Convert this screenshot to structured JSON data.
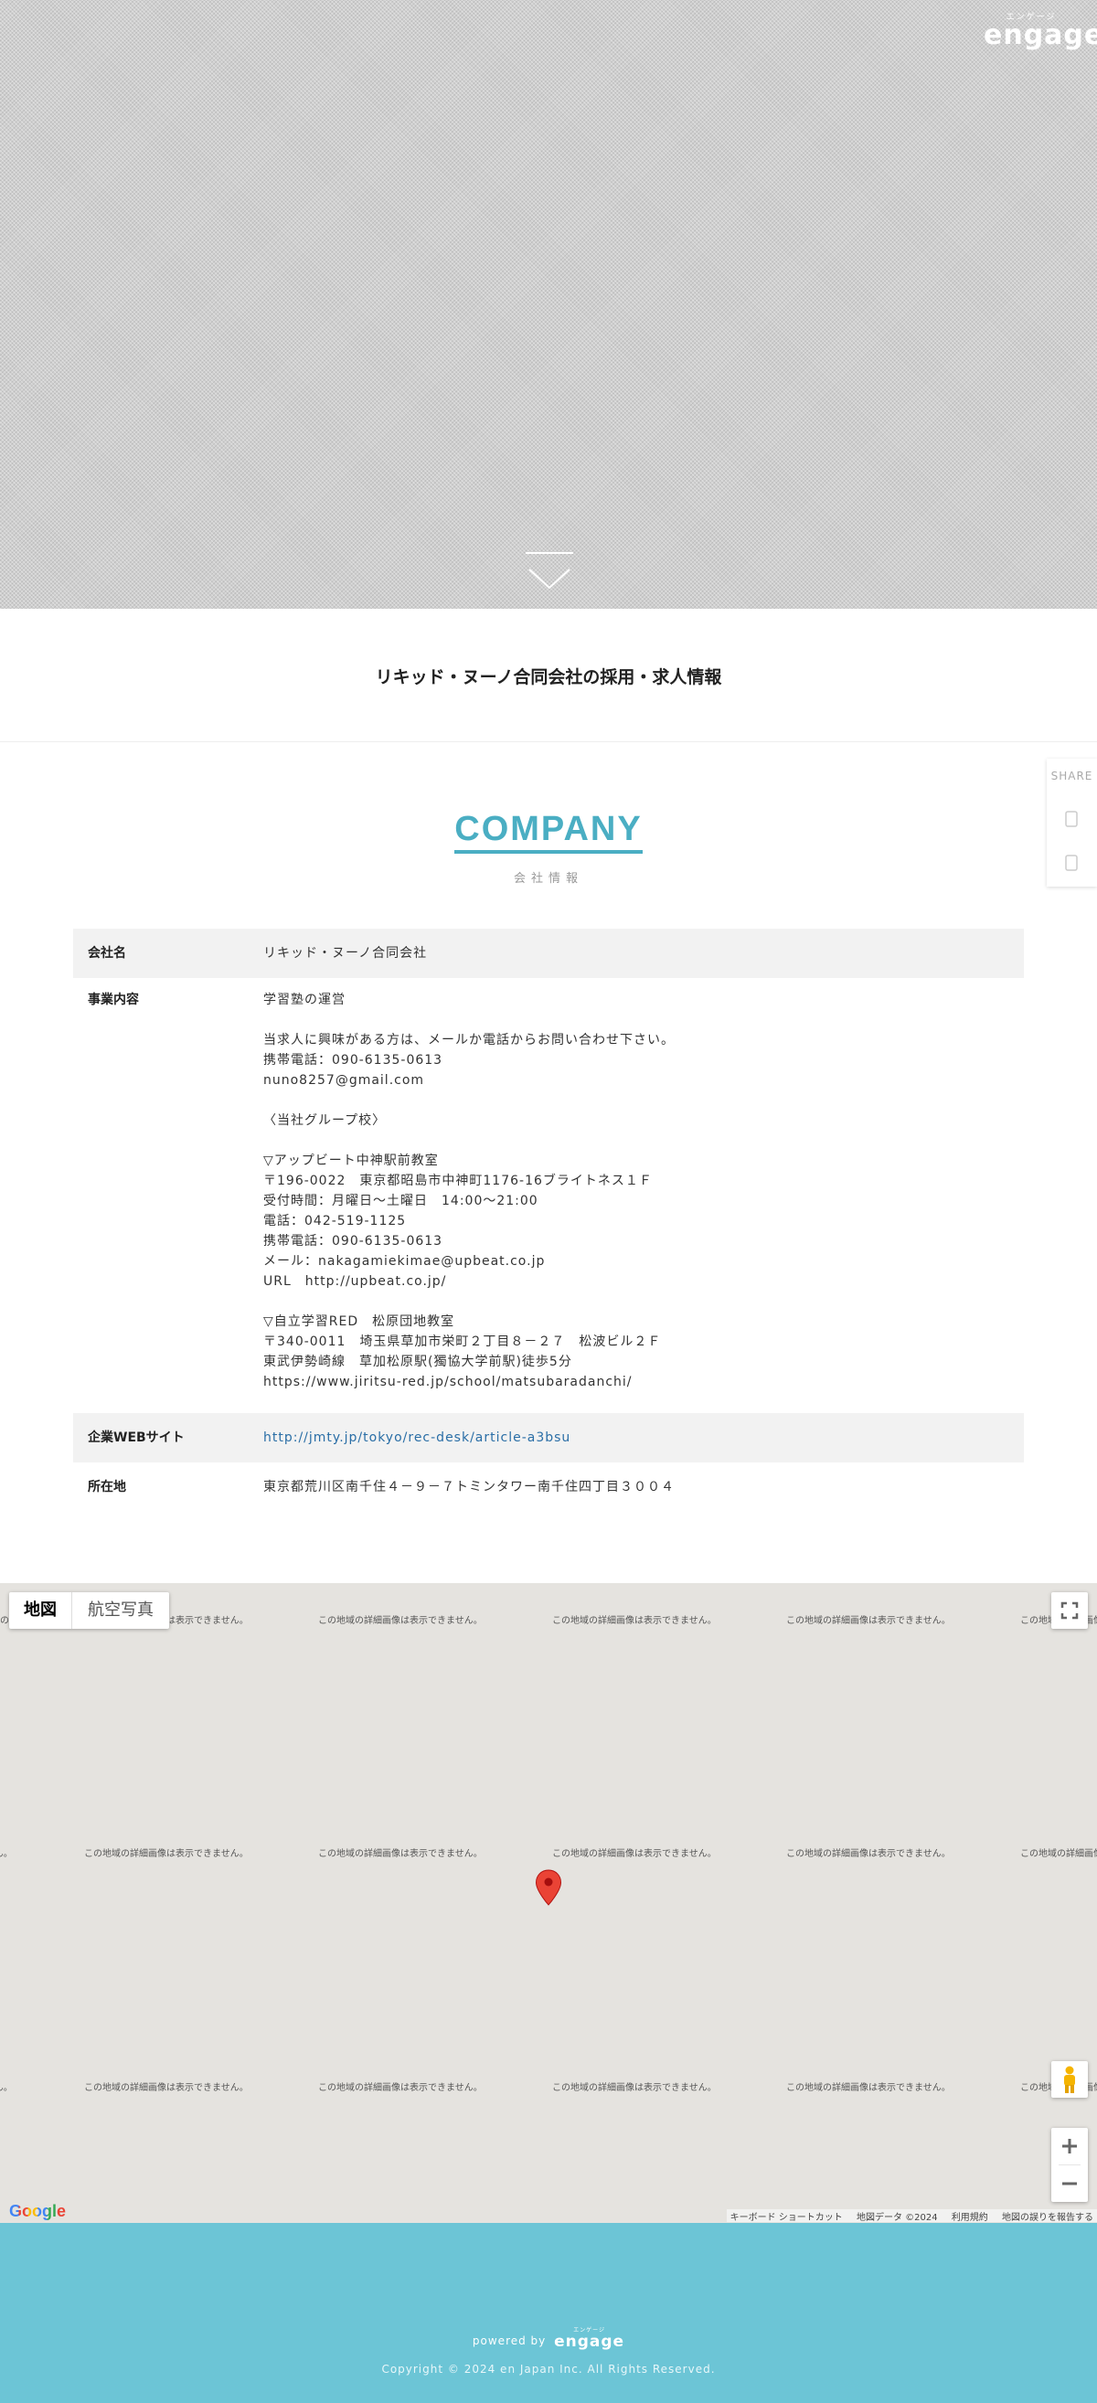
{
  "header": {
    "logo_kana": "エンゲージ",
    "logo_word": "engage"
  },
  "page_title": "リキッド・ヌーノ合同会社の採用・求人情報",
  "share": {
    "label": "SHARE"
  },
  "company": {
    "heading_en": "COMPANY",
    "heading_ja": "会社情報",
    "rows": {
      "name": {
        "label": "会社名",
        "value": "リキッド・ヌーノ合同会社"
      },
      "business": {
        "label": "事業内容",
        "lines": [
          "学習塾の運営",
          "",
          "当求人に興味がある方は、メールか電話からお問い合わせ下さい。",
          "携帯電話：090-6135-0613",
          "nuno8257@gmail.com",
          "",
          "〈当社グループ校〉",
          "",
          "▽アップビート中神駅前教室",
          "〒196-0022　東京都昭島市中神町1176-16ブライトネス１Ｆ",
          "受付時間：月曜日～土曜日　14:00～21:00",
          "電話：042-519-1125",
          "携帯電話：090-6135-0613",
          "メール：nakagamiekimae@upbeat.co.jp",
          "URL　http://upbeat.co.jp/",
          "",
          "▽自立学習RED　松原団地教室",
          "〒340-0011　埼玉県草加市栄町２丁目８－２７　松波ビル２Ｆ",
          "東武伊勢崎線　草加松原駅(獨協大学前駅)徒歩5分",
          "https://www.jiritsu-red.jp/school/matsubaradanchi/"
        ]
      },
      "website": {
        "label": "企業WEBサイト",
        "value": "http://jmty.jp/tokyo/rec-desk/article-a3bsu"
      },
      "address": {
        "label": "所在地",
        "value": "東京都荒川区南千住４－９－７トミンタワー南千住四丁目３００４"
      }
    }
  },
  "map": {
    "type_map": "地図",
    "type_satellite": "航空写真",
    "tile_message": "この地域の詳細画像は表示できません。",
    "google_logo": "Google",
    "attribution": {
      "shortcuts": "キーボード ショートカット",
      "data": "地図データ ©2024",
      "terms": "利用規約",
      "report": "地図の誤りを報告する"
    }
  },
  "footer": {
    "powered_by": "powered by",
    "logo_kana": "エンゲージ",
    "logo_word": "engage",
    "copyright": "Copyright © 2024 en Japan Inc. All Rights Reserved."
  },
  "colors": {
    "accent": "#4aaec3",
    "footer_bg": "#6cc5d6",
    "link": "#2a6ea6",
    "marker": "#ea4335"
  }
}
